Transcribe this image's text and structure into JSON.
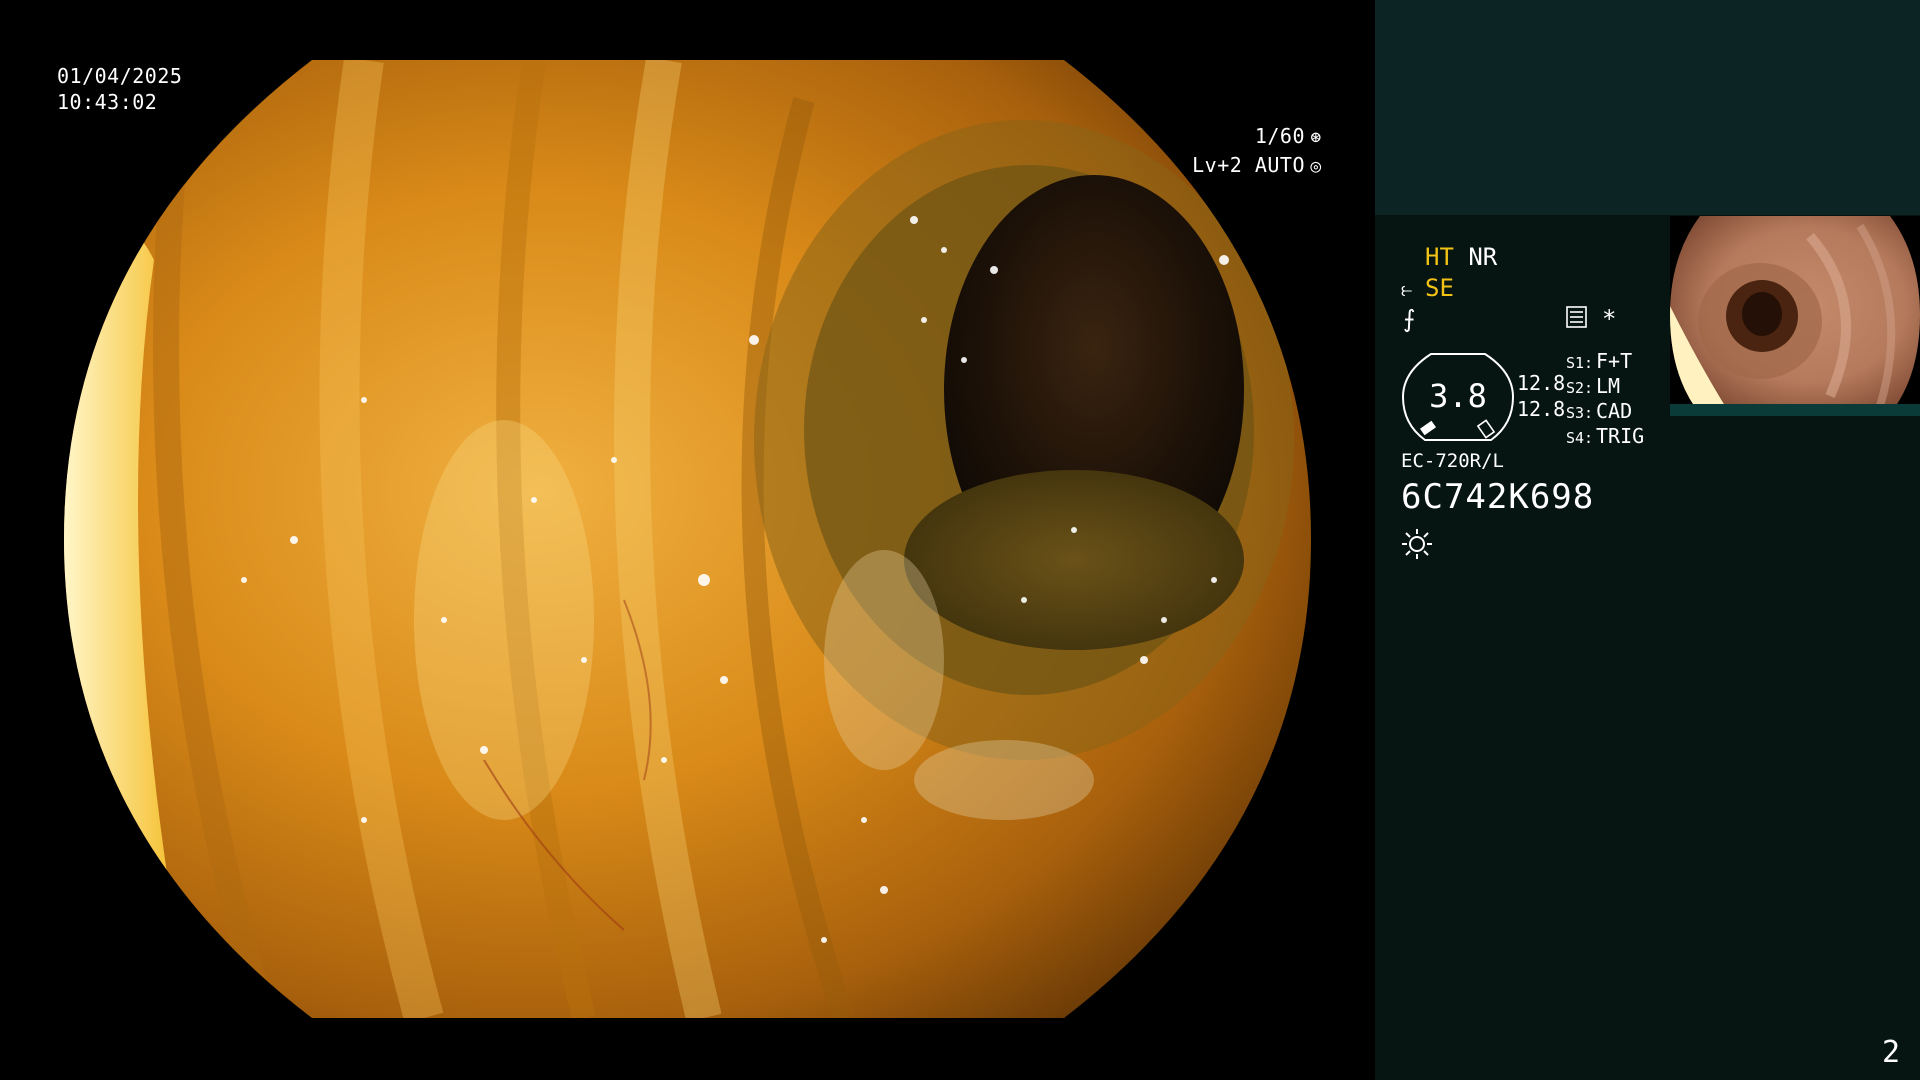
{
  "overlay": {
    "date": "01/04/2025",
    "time": "10:43:02",
    "shutter": "1/60",
    "shutter_icon": "aperture-icon",
    "level": "Lv+2 AUTO",
    "level_icon": "iris-icon"
  },
  "panel": {
    "ht": "HT",
    "nr": "NR",
    "se": "SE",
    "se_icon": "scope-tip-icon",
    "freeze_icon": "freeze-icon",
    "asterisk": "*",
    "menu_icon": "menu-list-icon",
    "gauge_value": "3.8",
    "gauge_right_1": "12.8",
    "gauge_right_2": "12.8",
    "switches": [
      {
        "num": "S1:",
        "label": "F+T"
      },
      {
        "num": "S2:",
        "label": "LM"
      },
      {
        "num": "S3:",
        "label": "CAD"
      },
      {
        "num": "S4:",
        "label": "TRIG"
      }
    ],
    "scope_model": "EC-720R/L",
    "scope_serial": "6C742K698",
    "light_icon": "light-source-icon"
  },
  "page_number": "2",
  "colors": {
    "panel_bg": "#061412",
    "panel_top_bg": "#0c2423",
    "accent_yellow": "#f2c314",
    "text": "#ffffff"
  }
}
